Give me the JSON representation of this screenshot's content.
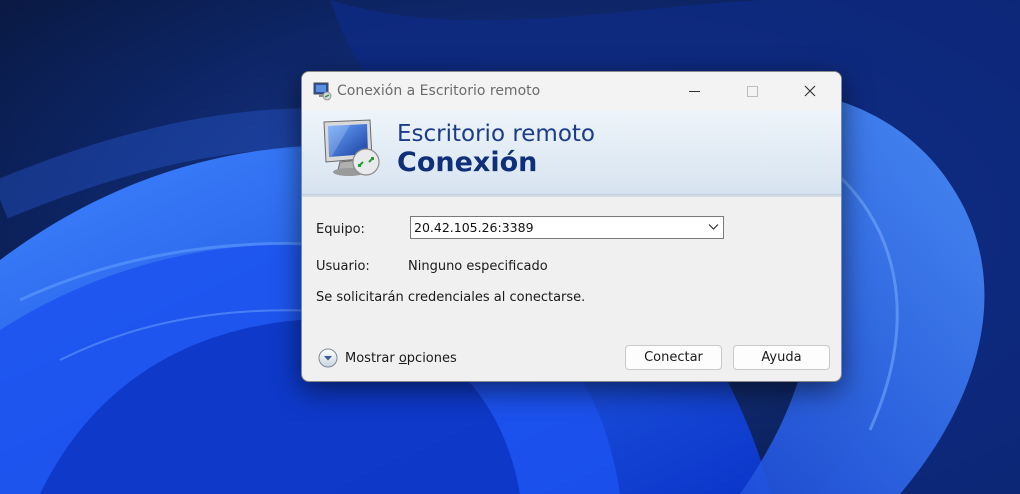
{
  "window": {
    "title": "Conexión a Escritorio remoto"
  },
  "banner": {
    "line1": "Escritorio remoto",
    "line2": "Conexión"
  },
  "form": {
    "computer_label": "Equipo:",
    "computer_value": "20.42.105.26:3389",
    "user_label": "Usuario:",
    "user_value": "Ninguno especificado",
    "credentials_note": "Se solicitarán credenciales al conectarse."
  },
  "footer": {
    "show_options_prefix": "Mostrar ",
    "show_options_mnemonic": "o",
    "show_options_suffix": "pciones",
    "connect_label": "Conectar",
    "help_label": "Ayuda"
  },
  "icons": {
    "app": "remote-desktop-icon",
    "banner": "remote-desktop-monitor-icon",
    "dropdown": "chevron-down-icon",
    "expand": "expand-circle-icon",
    "minimize": "minimize-icon",
    "maximize": "maximize-icon",
    "close": "close-icon"
  },
  "colors": {
    "banner_title": "#0f2f7a",
    "wallpaper_dark": "#0a1a44",
    "wallpaper_accent": "#1f5ef5"
  }
}
